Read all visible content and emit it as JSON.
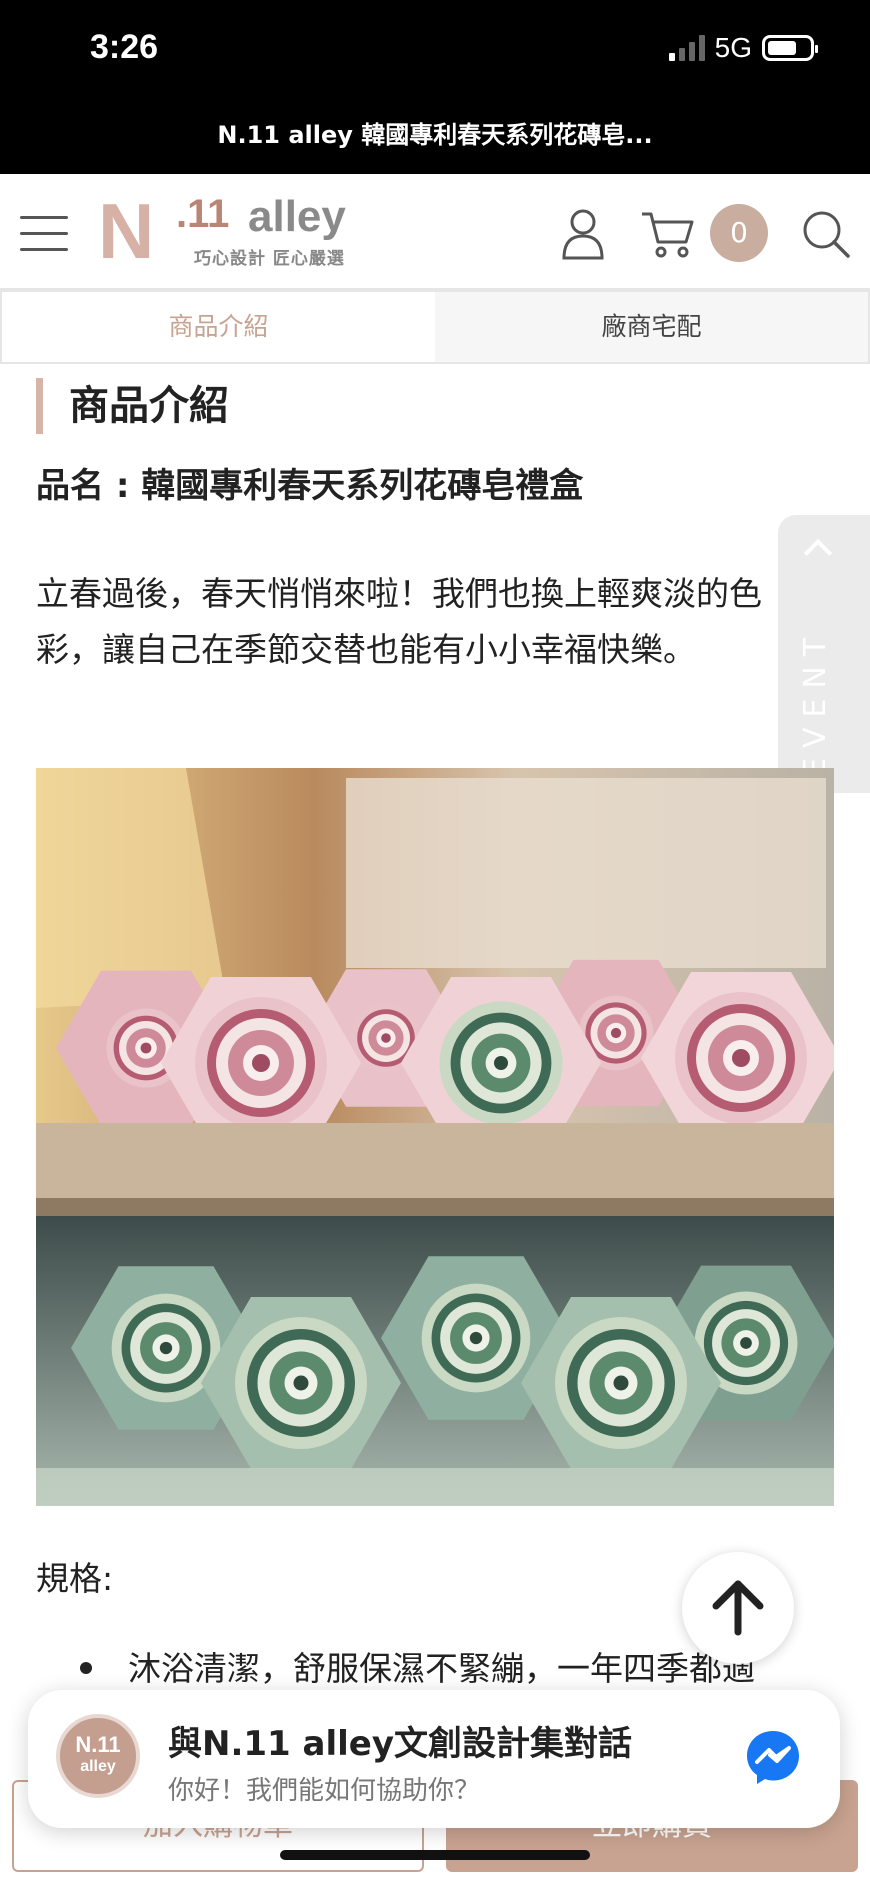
{
  "status_bar": {
    "time": "3:26",
    "network": "5G"
  },
  "browser": {
    "page_title": "N.11 alley 韓國專利春天系列花磚皂..."
  },
  "header": {
    "logo": {
      "mark": "N",
      "number": ".11",
      "name": "alley",
      "tagline": "巧心設計 匠心嚴選"
    },
    "cart_count": "0",
    "icons": [
      "hamburger-icon",
      "user-icon",
      "cart-icon",
      "search-icon"
    ]
  },
  "tabs": [
    {
      "label": "商品介紹",
      "active": true
    },
    {
      "label": "廠商宅配",
      "active": false
    }
  ],
  "content": {
    "section_title": "商品介紹",
    "product_name": "品名 : 韓國專利春天系列花磚皂禮盒",
    "intro": "立春過後，春天悄悄來啦！我們也換上輕爽淡的色彩，讓自己在季節交替也能有小小幸福快樂。",
    "spec_label": "規格:",
    "spec_items": [
      "沐浴清潔，舒服保濕不緊繃，一年四季都適"
    ]
  },
  "event_tab": {
    "label": "EVENT"
  },
  "chat": {
    "avatar_top": "N.11",
    "avatar_bottom": "alley",
    "title": "與N.11 alley文創設計集對話",
    "subtitle": "你好！我們能如何協助你？"
  },
  "bottom_bar": {
    "add_to_cart": "加入購物車",
    "buy_now": "立即購買"
  },
  "colors": {
    "accent": "#c9a391",
    "badge": "#c9ad9f",
    "messenger": "#1877f2"
  }
}
